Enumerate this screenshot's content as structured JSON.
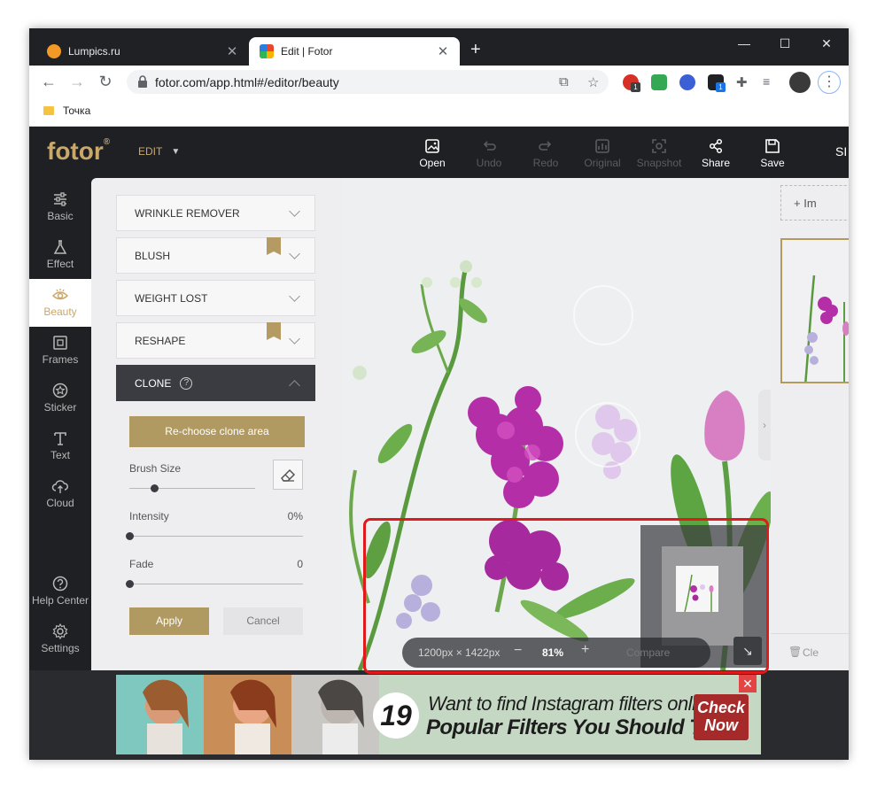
{
  "browser": {
    "tabs": [
      {
        "title": "Lumpics.ru",
        "favicon_color": "#f29a25"
      },
      {
        "title": "Edit | Fotor",
        "favicon_color": "#e9462f"
      }
    ],
    "url": "fotor.com/app.html#/editor/beauty",
    "extension_badges": [
      "1",
      "1"
    ],
    "bookmark": "Точка"
  },
  "app": {
    "logo": "fotor",
    "logo_mark": "®",
    "mode_menu": "EDIT",
    "tools": [
      {
        "label": "Open",
        "icon": "image-icon",
        "enabled": true
      },
      {
        "label": "Undo",
        "icon": "undo-icon",
        "enabled": false
      },
      {
        "label": "Redo",
        "icon": "redo-icon",
        "enabled": false
      },
      {
        "label": "Original",
        "icon": "original-icon",
        "enabled": false
      },
      {
        "label": "Snapshot",
        "icon": "snapshot-icon",
        "enabled": false
      },
      {
        "label": "Share",
        "icon": "share-icon",
        "enabled": true
      },
      {
        "label": "Save",
        "icon": "save-icon",
        "enabled": true
      }
    ],
    "sign_in_partial": "SI",
    "accent_color": "#b09a62"
  },
  "sidebar": {
    "items": [
      {
        "label": "Basic",
        "icon": "sliders-icon"
      },
      {
        "label": "Effect",
        "icon": "flask-icon"
      },
      {
        "label": "Beauty",
        "icon": "eye-icon",
        "active": true
      },
      {
        "label": "Frames",
        "icon": "frame-icon"
      },
      {
        "label": "Sticker",
        "icon": "star-icon"
      },
      {
        "label": "Text",
        "icon": "text-icon"
      },
      {
        "label": "Cloud",
        "icon": "cloud-icon"
      }
    ],
    "bottom_items": [
      {
        "label": "Help Center",
        "icon": "help-icon"
      },
      {
        "label": "Settings",
        "icon": "gear-icon"
      }
    ]
  },
  "beauty_panel": {
    "sections": [
      {
        "label": "WRINKLE REMOVER",
        "premium": false
      },
      {
        "label": "BLUSH",
        "premium": true
      },
      {
        "label": "WEIGHT LOST",
        "premium": false
      },
      {
        "label": "RESHAPE",
        "premium": true
      }
    ],
    "open_section": "CLONE",
    "help_glyph": "?",
    "rechoose_label": "Re-choose clone area",
    "brush_size_label": "Brush Size",
    "brush_size_level": 0.2,
    "intensity_label": "Intensity",
    "intensity_value": "0%",
    "intensity_level": 0,
    "fade_label": "Fade",
    "fade_value": "0",
    "fade_level": 0,
    "apply_label": "Apply",
    "cancel_label": "Cancel"
  },
  "canvas": {
    "dimensions": "1200px × 1422px",
    "zoom_minus": "−",
    "zoom": "81%",
    "zoom_plus": "+",
    "compare_label": "Compare",
    "highlight_color": "#e01a1a"
  },
  "right_panel": {
    "import_label": "+ Im",
    "clear_label": "Cle"
  },
  "ad": {
    "number": "19",
    "line1": "Want to find Instagram filters online?",
    "line2": "Popular Filters You Should Try",
    "cta_line1": "Check",
    "cta_line2": "Now",
    "close": "✕"
  }
}
